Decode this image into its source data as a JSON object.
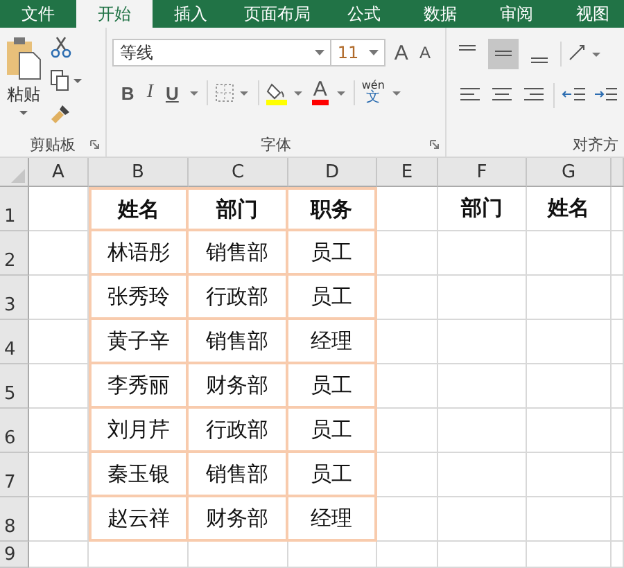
{
  "tabs": [
    {
      "label": "文件",
      "selected": false
    },
    {
      "label": "开始",
      "selected": true
    },
    {
      "label": "插入",
      "selected": false
    },
    {
      "label": "页面布局",
      "selected": false
    },
    {
      "label": "公式",
      "selected": false
    },
    {
      "label": "数据",
      "selected": false
    },
    {
      "label": "审阅",
      "selected": false
    },
    {
      "label": "视图",
      "selected": false
    }
  ],
  "ribbon": {
    "clipboard": {
      "paste_label": "粘贴",
      "group_label": "剪贴板"
    },
    "font": {
      "font_name": "等线",
      "font_size": "11",
      "grow_glyph": "A",
      "shrink_glyph": "A",
      "bold": "B",
      "italic": "I",
      "underline": "U",
      "font_color_glyph": "A",
      "phonetic_top": "wén",
      "phonetic_bottom": "文",
      "group_label": "字体"
    },
    "alignment": {
      "vertical_align": [
        {
          "kind": "top",
          "selected": false
        },
        {
          "kind": "middle",
          "selected": true
        },
        {
          "kind": "bottom",
          "selected": false
        }
      ],
      "group_label": "对齐方"
    }
  },
  "sheet": {
    "columns": [
      "A",
      "B",
      "C",
      "D",
      "E",
      "F",
      "G"
    ],
    "row_numbers": [
      "1",
      "2",
      "3",
      "4",
      "5",
      "6",
      "7",
      "8",
      "9"
    ],
    "table": {
      "header": [
        "姓名",
        "部门",
        "职务"
      ],
      "rows": [
        [
          "林语彤",
          "销售部",
          "员工"
        ],
        [
          "张秀玲",
          "行政部",
          "员工"
        ],
        [
          "黄子辛",
          "销售部",
          "经理"
        ],
        [
          "李秀丽",
          "财务部",
          "员工"
        ],
        [
          "刘月芹",
          "行政部",
          "员工"
        ],
        [
          "秦玉银",
          "销售部",
          "员工"
        ],
        [
          "赵云祥",
          "财务部",
          "经理"
        ]
      ]
    },
    "lookup_header": [
      "部门",
      "姓名"
    ]
  }
}
